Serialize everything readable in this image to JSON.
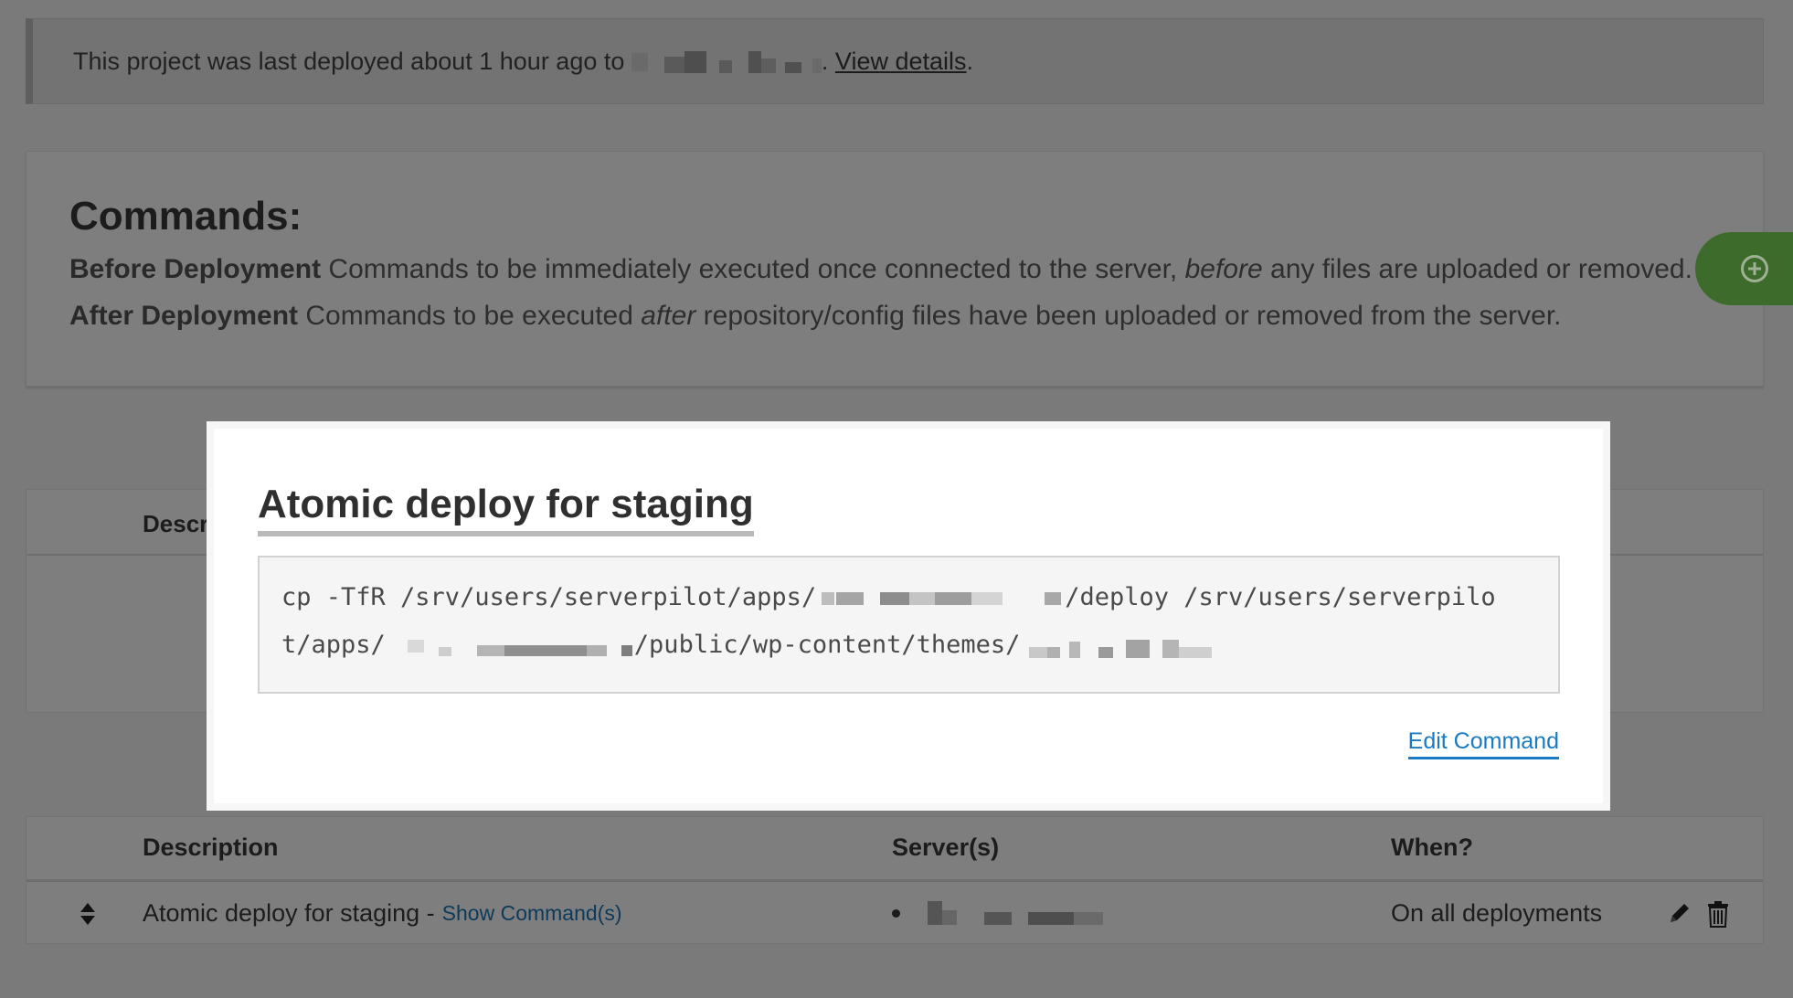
{
  "notice": {
    "text": "This project was last deployed about 1 hour ago to",
    "link": "View details",
    "suffix": "."
  },
  "commands": {
    "title": "Commands:",
    "before_label": "Before Deployment",
    "before_text_1": "Commands to be immediately executed once connected to the server,",
    "before_em": "before",
    "before_text_2": "any files are uploaded or removed.",
    "after_label": "After Deployment",
    "after_text_1": "Commands to be executed",
    "after_em": "after",
    "after_text_2": "repository/config files have been uploaded or removed from the server."
  },
  "background_table": {
    "header_partial": "Descr"
  },
  "table": {
    "columns": [
      "Description",
      "Server(s)",
      "When?"
    ],
    "row": {
      "description": "Atomic deploy for staging -",
      "show_link": "Show Command(s)",
      "when": "On all deployments"
    }
  },
  "modal": {
    "title": "Atomic deploy for staging",
    "line1_a": "cp -TfR /srv/users/serverpilot/apps/",
    "line1_b": "/deploy /srv/users/serverpilo",
    "line2_a": "t/apps/",
    "line2_b": "/public/wp-content/themes/",
    "edit_label": "Edit Command"
  },
  "colors": {
    "overlay_bg": "#7a7a7a",
    "add_button": "#3c6b2b",
    "link_blue": "#1a7bc4"
  },
  "icons": [
    "plus-circle-icon",
    "sort-icon",
    "pencil-icon",
    "trash-icon"
  ]
}
